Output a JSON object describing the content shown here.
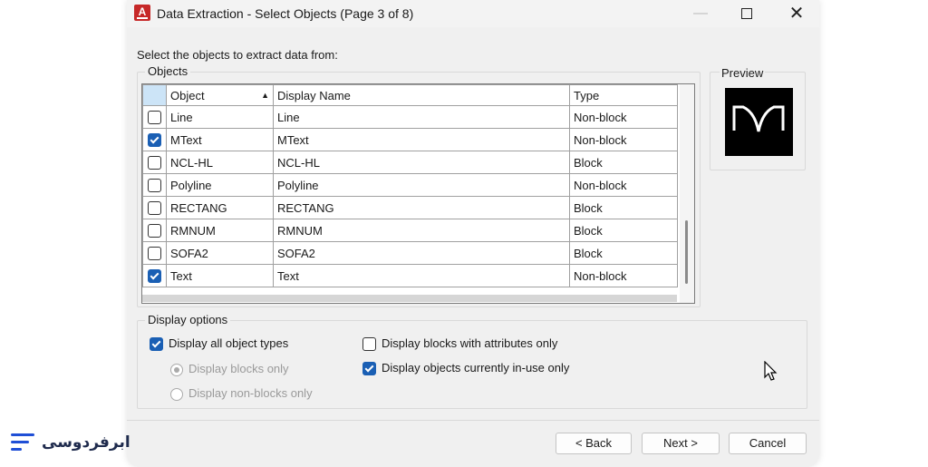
{
  "window": {
    "title": "Data Extraction - Select Objects (Page 3 of 8)",
    "icon_letter": "A"
  },
  "instruction": "Select the objects to extract data from:",
  "objects": {
    "group_label": "Objects",
    "columns": [
      "Object",
      "Display Name",
      "Type"
    ],
    "sort_column": "Object",
    "rows": [
      {
        "checked": false,
        "object": "Line",
        "display_name": "Line",
        "type": "Non-block"
      },
      {
        "checked": true,
        "object": "MText",
        "display_name": "MText",
        "type": "Non-block"
      },
      {
        "checked": false,
        "object": "NCL-HL",
        "display_name": "NCL-HL",
        "type": "Block"
      },
      {
        "checked": false,
        "object": "Polyline",
        "display_name": "Polyline",
        "type": "Non-block"
      },
      {
        "checked": false,
        "object": "RECTANG",
        "display_name": "RECTANG",
        "type": "Block"
      },
      {
        "checked": false,
        "object": "RMNUM",
        "display_name": "RMNUM",
        "type": "Block"
      },
      {
        "checked": false,
        "object": "SOFA2",
        "display_name": "SOFA2",
        "type": "Block"
      },
      {
        "checked": true,
        "object": "Text",
        "display_name": "Text",
        "type": "Non-block"
      }
    ]
  },
  "preview": {
    "label": "Preview"
  },
  "display_options": {
    "group_label": "Display options",
    "all_types": {
      "label": "Display all object types",
      "checked": true
    },
    "blocks_only": {
      "label": "Display blocks only",
      "selected": true,
      "enabled": false
    },
    "non_blocks_only": {
      "label": "Display non-blocks only",
      "selected": false,
      "enabled": false
    },
    "attributes_only": {
      "label": "Display blocks with attributes only",
      "checked": false
    },
    "in_use_only": {
      "label": "Display objects currently in-use only",
      "checked": true
    }
  },
  "buttons": {
    "back": "< Back",
    "next": "Next >",
    "cancel": "Cancel"
  },
  "watermark": {
    "text": "ابرفردوسی",
    "color": "#1f4fd6"
  }
}
